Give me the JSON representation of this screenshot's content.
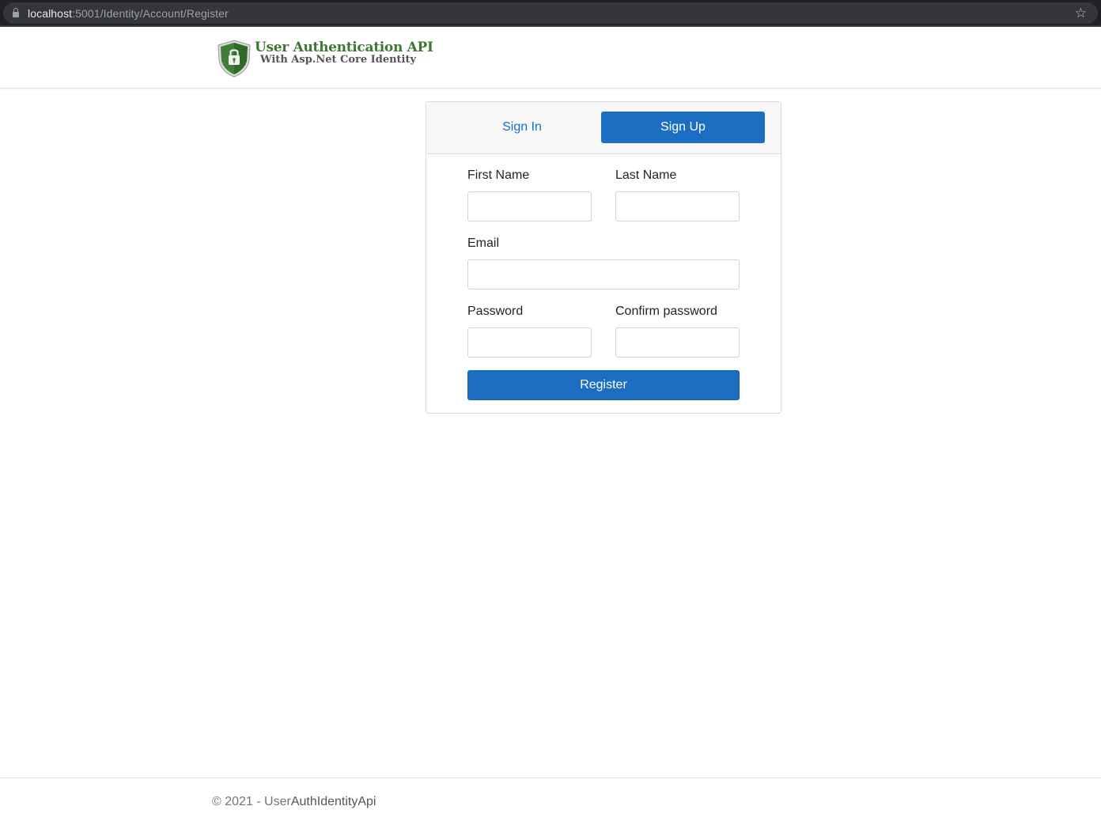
{
  "browser": {
    "url_host": "localhost",
    "url_path": ":5001/Identity/Account/Register",
    "lock_icon": "lock-icon",
    "bookmark_icon": "star-icon"
  },
  "header": {
    "logo_icon": "shield-lock-icon",
    "title": "User Authentication API",
    "subtitle": "With Asp.Net Core Identity"
  },
  "tabs": {
    "sign_in": "Sign In",
    "sign_up": "Sign Up"
  },
  "form": {
    "first_name_label": "First Name",
    "first_name_value": "",
    "last_name_label": "Last Name",
    "last_name_value": "",
    "email_label": "Email",
    "email_value": "",
    "password_label": "Password",
    "password_value": "",
    "confirm_password_label": "Confirm password",
    "confirm_password_value": "",
    "submit_label": "Register"
  },
  "footer": {
    "copyright": "© 2021 - User",
    "app_name": "AuthIdentityApi"
  },
  "colors": {
    "primary": "#1b6ec2",
    "link": "#1a6fc4",
    "brand_green": "#3b7a2e"
  }
}
